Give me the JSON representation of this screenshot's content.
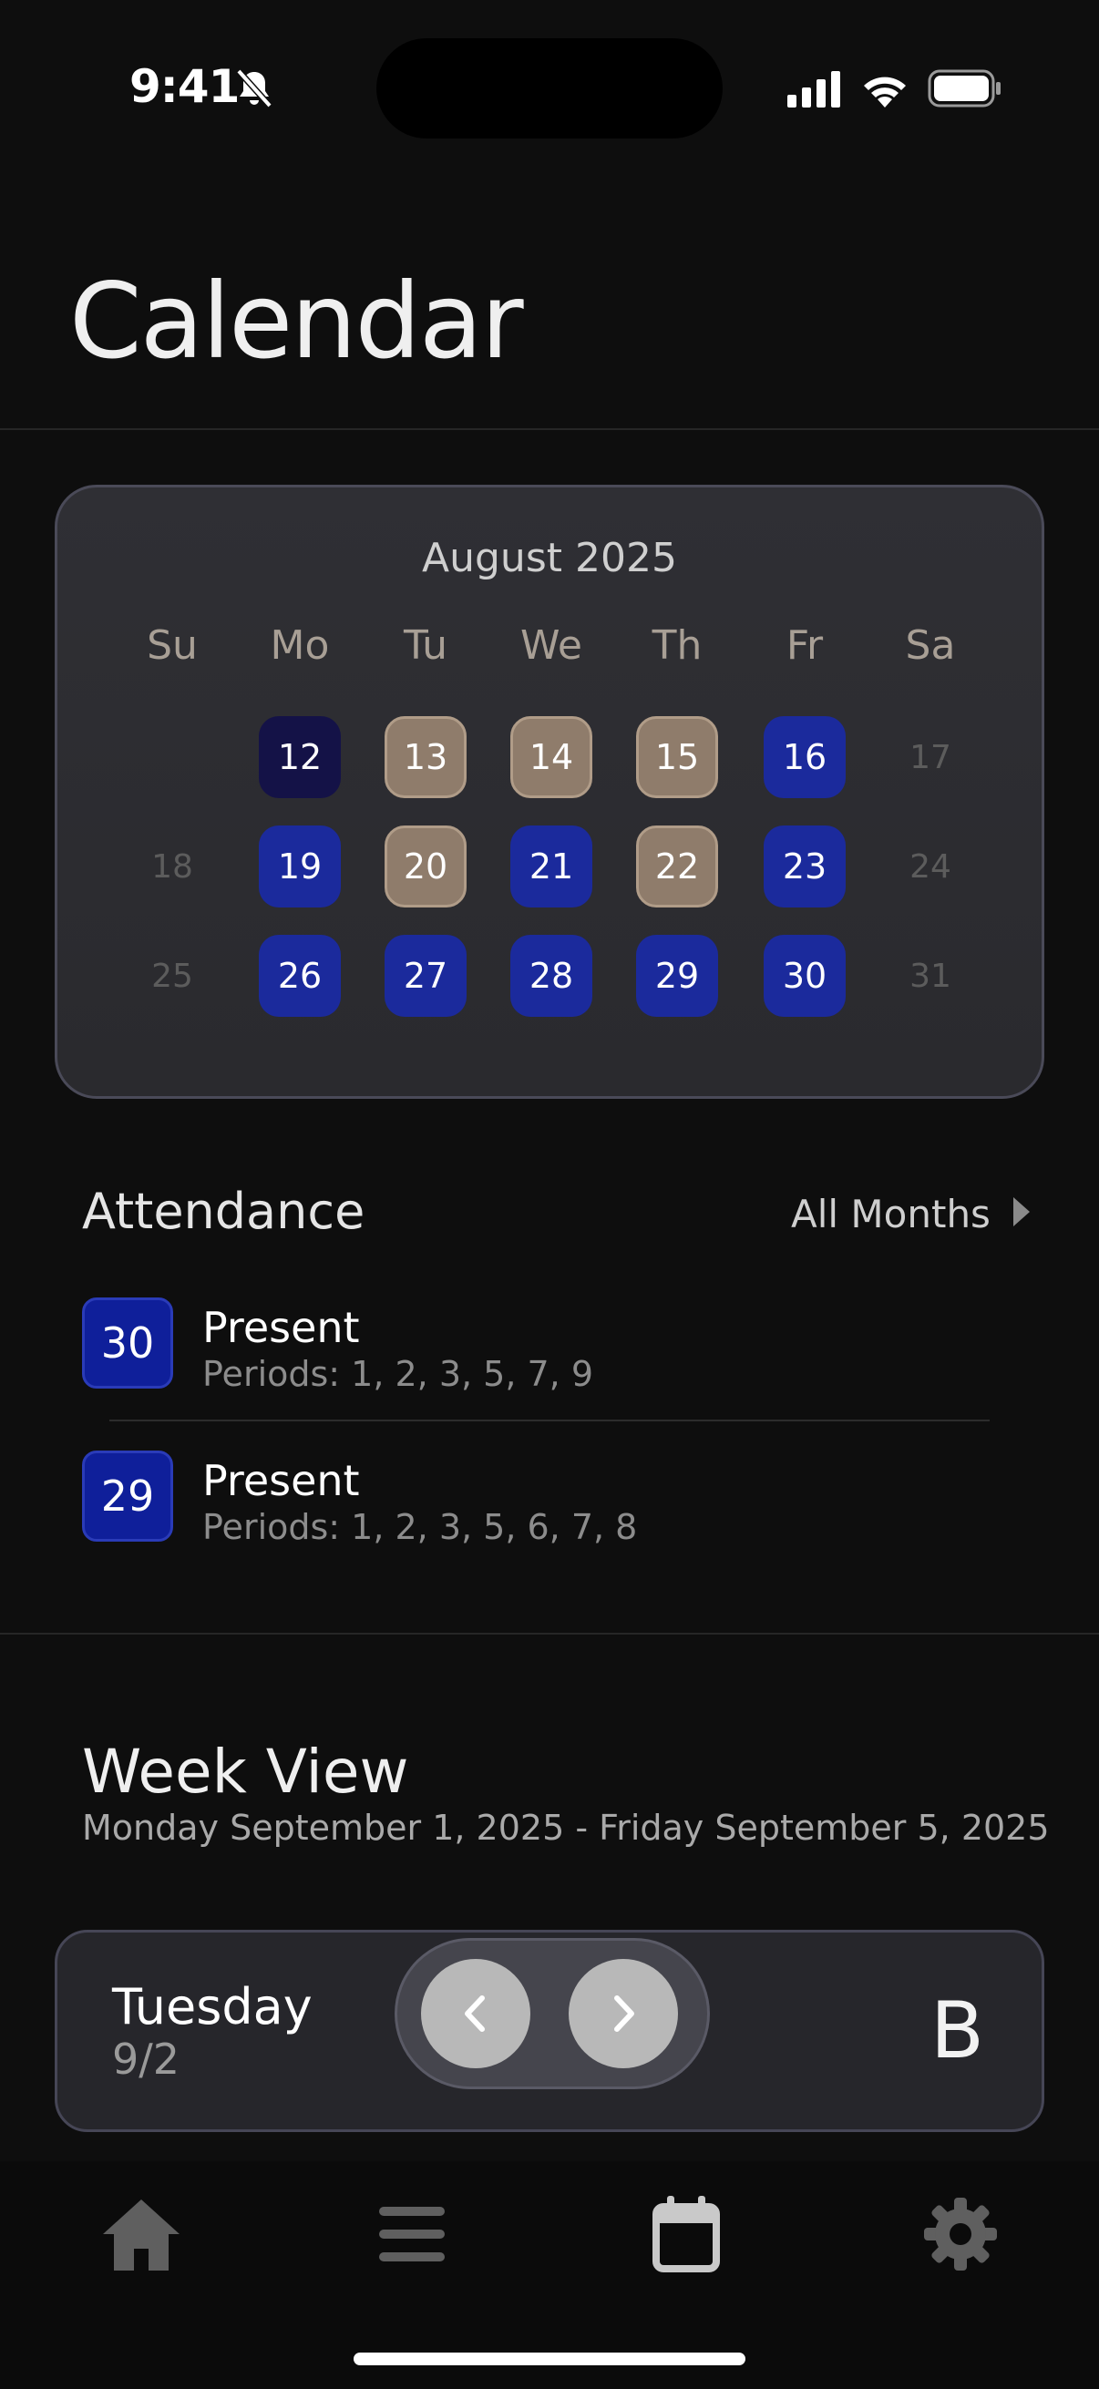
{
  "status_bar": {
    "time": "9:41"
  },
  "page_title": "Calendar",
  "calendar": {
    "month_label": "August 2025",
    "weekdays": [
      "Su",
      "Mo",
      "Tu",
      "We",
      "Th",
      "Fr",
      "Sa"
    ],
    "weeks": [
      [
        null,
        {
          "d": "12",
          "s": "dark"
        },
        {
          "d": "13",
          "s": "tan"
        },
        {
          "d": "14",
          "s": "tan"
        },
        {
          "d": "15",
          "s": "tan"
        },
        {
          "d": "16",
          "s": "blue"
        },
        {
          "d": "17",
          "s": "muted"
        }
      ],
      [
        {
          "d": "18",
          "s": "muted"
        },
        {
          "d": "19",
          "s": "blue"
        },
        {
          "d": "20",
          "s": "tan"
        },
        {
          "d": "21",
          "s": "blue"
        },
        {
          "d": "22",
          "s": "tan"
        },
        {
          "d": "23",
          "s": "blue"
        },
        {
          "d": "24",
          "s": "muted"
        }
      ],
      [
        {
          "d": "25",
          "s": "muted"
        },
        {
          "d": "26",
          "s": "blue"
        },
        {
          "d": "27",
          "s": "blue"
        },
        {
          "d": "28",
          "s": "blue"
        },
        {
          "d": "29",
          "s": "blue"
        },
        {
          "d": "30",
          "s": "blue"
        },
        {
          "d": "31",
          "s": "muted"
        }
      ]
    ],
    "colors": {
      "blue": "#1b2a9c",
      "dark": "#141247",
      "tan": "#8f7c6b"
    }
  },
  "attendance": {
    "title": "Attendance",
    "all_months_label": "All Months",
    "records": [
      {
        "day": "30",
        "status": "Present",
        "periods": "Periods: 1, 2, 3, 5, 7, 9"
      },
      {
        "day": "29",
        "status": "Present",
        "periods": "Periods: 1, 2, 3, 5, 6, 7, 8"
      }
    ]
  },
  "week_view": {
    "title": "Week View",
    "range": "Monday September 1, 2025 - Friday September 5, 2025",
    "day_name": "Tuesday",
    "day_date": "9/2",
    "day_letter": "B"
  },
  "tab_bar": {
    "items": [
      {
        "icon": "home-icon",
        "selected": false
      },
      {
        "icon": "menu-icon",
        "selected": false
      },
      {
        "icon": "calendar-icon",
        "selected": true
      },
      {
        "icon": "gear-icon",
        "selected": false
      }
    ]
  }
}
